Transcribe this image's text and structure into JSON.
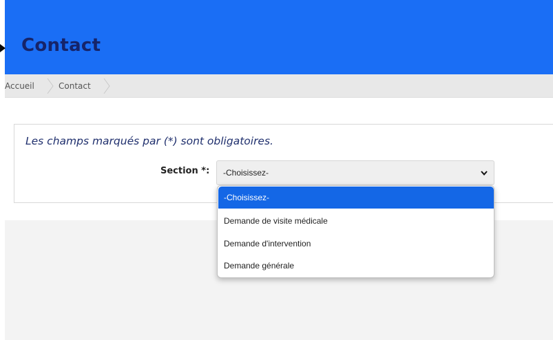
{
  "header": {
    "title": "Contact"
  },
  "breadcrumb": {
    "items": [
      "Accueil",
      "Contact"
    ]
  },
  "form": {
    "required_note": "Les champs marqués par (*) sont obligatoires.",
    "section_label": "Section *:",
    "section_select": {
      "value": "-Choisissez-",
      "options": [
        "-Choisissez-",
        "Demande de visite médicale",
        "Demande d'intervention",
        "Demande générale"
      ],
      "selected_index": 0,
      "open": true
    }
  },
  "colors": {
    "header_bg": "#1a6ef5",
    "header_title": "#16246a",
    "selected_option": "#1467e6",
    "note_text": "#1f2f6d"
  },
  "icons": {
    "header_marker": "triangle-right-icon",
    "breadcrumb_separator": "chevron-right-icon",
    "select_chevron": "chevron-down-icon"
  }
}
